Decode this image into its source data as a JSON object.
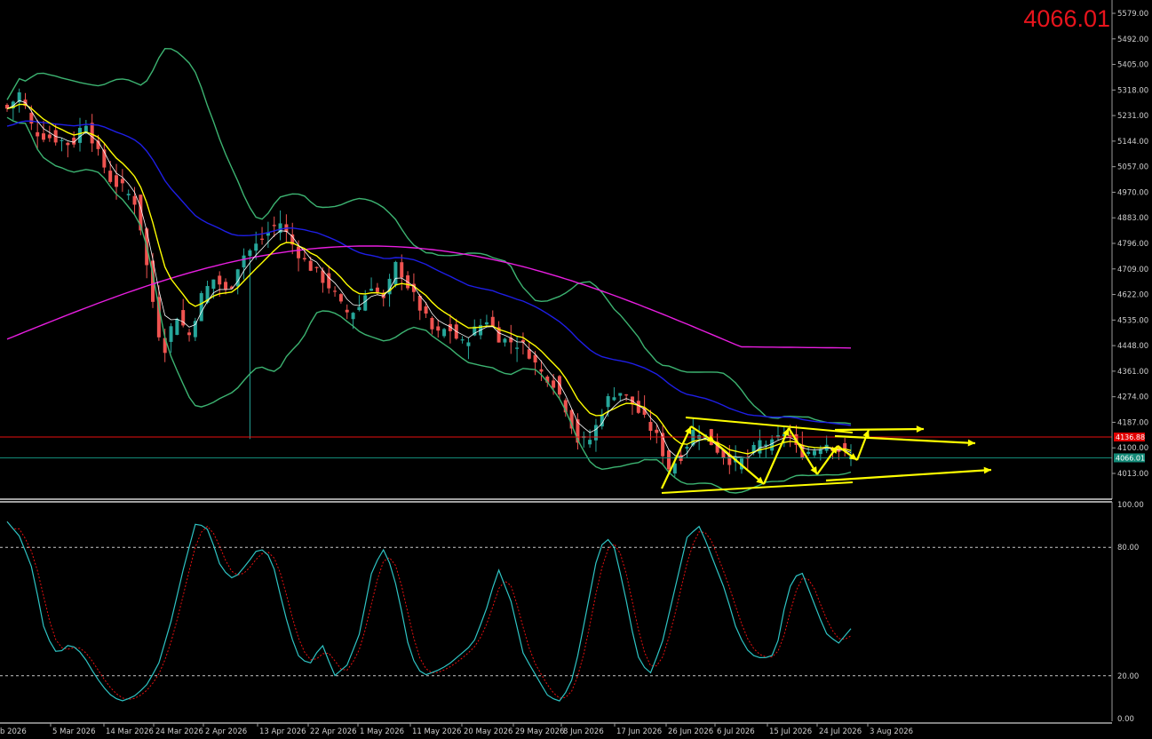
{
  "instrument_price_display": "4066.01",
  "colors": {
    "background": "#000000",
    "bull_candle": "#26a69a",
    "bear_candle": "#ef5350",
    "ema_fast": "#ffffff",
    "ema_slow": "#ffff00",
    "bollinger": "#3cb371",
    "ma_blue": "#1e1ee6",
    "ma_magenta": "#e81ee0",
    "annotation": "#ffff00",
    "resistance_line": "#e81010",
    "current_price_line": "#138a78",
    "stoch_main": "#2ec4c4",
    "stoch_signal": "#e81010"
  },
  "chart_data": [
    {
      "type": "candlestick",
      "panel": "price",
      "y_ticks": [
        "5579.00",
        "5492.00",
        "5405.00",
        "5318.00",
        "5231.00",
        "5144.00",
        "5057.00",
        "4970.00",
        "4883.00",
        "4796.00",
        "4709.00",
        "4622.00",
        "4535.00",
        "4448.00",
        "4361.00",
        "4274.00",
        "4187.00",
        "4100.00",
        "4013.00"
      ],
      "ylim": [
        3950,
        5600
      ],
      "x_ticks": [
        "b 2026",
        "5 Mar 2026",
        "14 Mar 2026",
        "24 Mar 2026",
        "2 Apr 2026",
        "13 Apr 2026",
        "22 Apr 2026",
        "1 May 2026",
        "11 May 2026",
        "20 May 2026",
        "29 May 2026",
        "8 Jun 2026",
        "17 Jun 2026",
        "26 Jun 2026",
        "6 Jul 2026",
        "15 Jul 2026",
        "24 Jul 2026",
        "3 Aug 2026"
      ],
      "close_anchors": [
        5255,
        5310,
        5180,
        5160,
        5150,
        5130,
        5220,
        5100,
        5010,
        4980,
        4930,
        4650,
        4420,
        4560,
        4480,
        4620,
        4680,
        4620,
        4750,
        4780,
        4830,
        4870,
        4790,
        4730,
        4690,
        4640,
        4560,
        4570,
        4660,
        4600,
        4730,
        4640,
        4560,
        4480,
        4510,
        4450,
        4500,
        4540,
        4470,
        4460,
        4440,
        4360,
        4330,
        4240,
        4120,
        4130,
        4250,
        4300,
        4260,
        4200,
        4140,
        4030,
        4080,
        4170,
        4130,
        4080,
        4050,
        4060,
        4120,
        4110,
        4160,
        4080,
        4090,
        4120,
        4095,
        4066
      ],
      "current_price": 4066.01,
      "resistance_level": 4136.88,
      "resistance_label": "4136.88",
      "current_label": "4066.01",
      "annotations": {
        "triangle_upper": [
          [
            772,
            470
          ],
          [
            960,
            487
          ]
        ],
        "triangle_lower": [
          [
            745,
            555
          ],
          [
            960,
            543
          ]
        ],
        "extension_arrows": [
          [
            [
              940,
              484
            ],
            [
              1040,
              483
            ]
          ],
          [
            [
              940,
              491
            ],
            [
              1098,
              499
            ]
          ],
          [
            [
              930,
              541
            ],
            [
              1116,
              529
            ]
          ]
        ],
        "zigzag": [
          [
            745,
            550
          ],
          [
            778,
            480
          ],
          [
            805,
            498
          ],
          [
            860,
            545
          ],
          [
            888,
            482
          ],
          [
            920,
            534
          ],
          [
            943,
            502
          ],
          [
            965,
            518
          ],
          [
            978,
            484
          ]
        ]
      }
    },
    {
      "type": "line",
      "panel": "stochastic",
      "y_ticks": [
        "100.00",
        "80.00",
        "20.00",
        "0.00"
      ],
      "ylim": [
        0,
        100
      ],
      "levels": [
        80,
        20
      ],
      "main_anchors": [
        92,
        85,
        70,
        40,
        30,
        35,
        30,
        20,
        12,
        8,
        10,
        15,
        25,
        45,
        70,
        92,
        88,
        70,
        65,
        72,
        80,
        75,
        50,
        30,
        25,
        35,
        20,
        25,
        40,
        70,
        80,
        60,
        30,
        20,
        22,
        25,
        30,
        35,
        50,
        70,
        55,
        30,
        20,
        10,
        8,
        20,
        50,
        80,
        85,
        60,
        30,
        20,
        35,
        60,
        85,
        90,
        75,
        60,
        40,
        30,
        28,
        30,
        60,
        70,
        55,
        40,
        35,
        42
      ]
    }
  ]
}
